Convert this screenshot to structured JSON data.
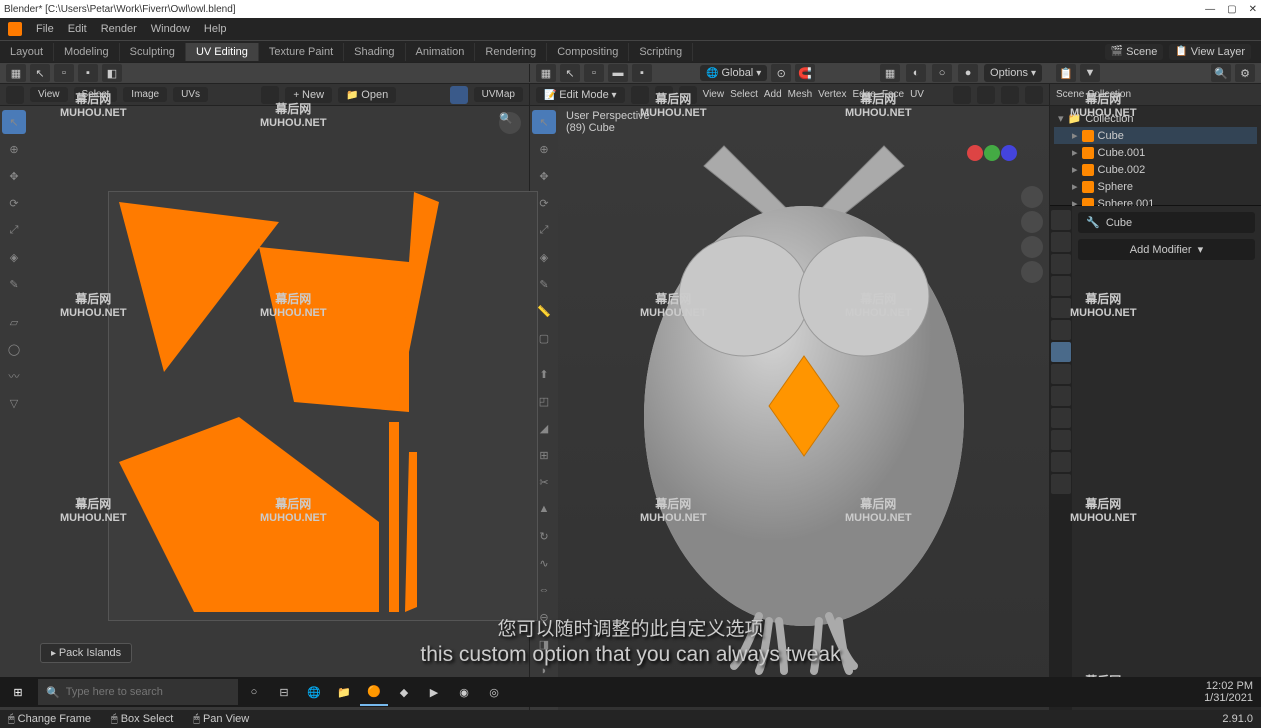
{
  "window": {
    "title": "Blender* [C:\\Users\\Petar\\Work\\Fiverr\\Owl\\owl.blend]"
  },
  "menu": [
    "File",
    "Edit",
    "Render",
    "Window",
    "Help"
  ],
  "workspaces": [
    "Layout",
    "Modeling",
    "Sculpting",
    "UV Editing",
    "Texture Paint",
    "Shading",
    "Animation",
    "Rendering",
    "Compositing",
    "Scripting"
  ],
  "workspace_active": "UV Editing",
  "topright": {
    "scene": "Scene",
    "viewlayer": "View Layer"
  },
  "uv": {
    "header": [
      "View",
      "Select",
      "Image",
      "UVs"
    ],
    "new": "New",
    "open": "Open",
    "uvmap": "UVMap",
    "sync": "UV Sync"
  },
  "view3d": {
    "mode": "Edit Mode",
    "header": [
      "View",
      "Select",
      "Add",
      "Mesh",
      "Vertex",
      "Edge",
      "Face",
      "UV"
    ],
    "orientation": "Global",
    "options": "Options",
    "persp": "User Perspective",
    "obj": "(89) Cube"
  },
  "outliner": {
    "title": "Scene Collection",
    "collection": "Collection",
    "items": [
      "Cube",
      "Cube.001",
      "Cube.002",
      "Sphere",
      "Sphere.001"
    ]
  },
  "props": {
    "objname": "Cube",
    "addmod": "Add Modifier"
  },
  "popup": "Pack Islands",
  "status": [
    "Change Frame",
    "Box Select",
    "Pan View"
  ],
  "version": "2.91.0",
  "subtitle": {
    "cn": "您可以随时调整的此自定义选项",
    "en": "this custom option that you can always tweak"
  },
  "taskbar": {
    "search": "Type here to search",
    "time": "12:02 PM",
    "date": "1/31/2021"
  },
  "watermark": {
    "cn": "幕后网",
    "en": "MUHOU.NET"
  }
}
